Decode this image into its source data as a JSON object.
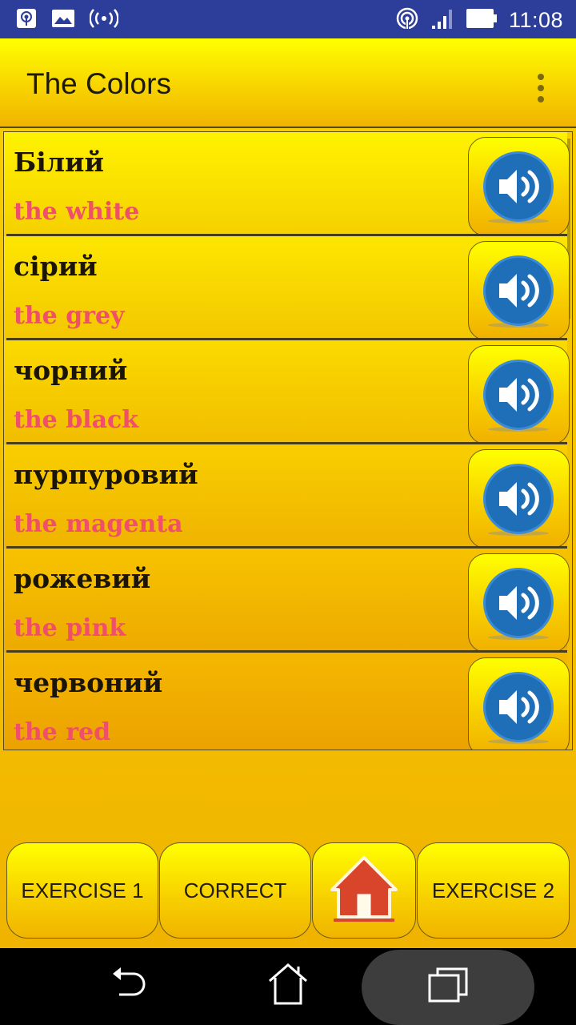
{
  "status_bar": {
    "left_icons": [
      "hotspot-icon",
      "image-icon",
      "broadcast-icon"
    ],
    "right_icons": [
      "hotspot-icon",
      "signal-icon",
      "battery-icon"
    ],
    "time": "11:08"
  },
  "app_bar": {
    "title": "The Colors",
    "menu_icon": "overflow-menu-icon"
  },
  "colors": {
    "status_bar_bg": "#2c3e9a",
    "accent_yellow": "#ffff00",
    "accent_orange": "#f0b400",
    "translation_text": "#ef4f68",
    "speaker_blue": "#1f6fb8",
    "home_red": "#d9452a"
  },
  "words": [
    {
      "ukrainian": "Білий",
      "english": "the white"
    },
    {
      "ukrainian": "сірий",
      "english": "the grey"
    },
    {
      "ukrainian": "чорний",
      "english": "the black"
    },
    {
      "ukrainian": "пурпуровий",
      "english": "the magenta"
    },
    {
      "ukrainian": "рожевий",
      "english": "the pink"
    },
    {
      "ukrainian": "червоний",
      "english": "the red"
    }
  ],
  "row_action_icon": "speaker-icon",
  "bottom_nav": {
    "exercise1": "EXERCISE 1",
    "correct": "CORRECT",
    "home_icon": "home-icon",
    "exercise2": "EXERCISE 2"
  },
  "system_nav": {
    "back": "back-icon",
    "home": "home-outline-icon",
    "recents": "recents-icon"
  }
}
